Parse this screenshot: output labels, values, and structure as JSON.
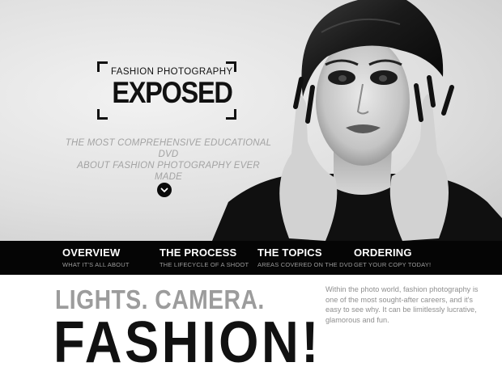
{
  "hero": {
    "logo_top": "FASHION PHOTOGRAPHY",
    "logo_main": "EXPOSED",
    "tagline_line1": "THE MOST COMPREHENSIVE EDUCATIONAL DVD",
    "tagline_line2": "ABOUT FASHION PHOTOGRAPHY EVER MADE",
    "scroll_icon": "chevron-down-icon"
  },
  "nav": {
    "items": [
      {
        "title": "OVERVIEW",
        "subtitle": "WHAT IT'S ALL ABOUT"
      },
      {
        "title": "THE PROCESS",
        "subtitle": "THE LIFECYCLE OF A SHOOT"
      },
      {
        "title": "THE TOPICS",
        "subtitle": "AREAS COVERED ON THE DVD"
      },
      {
        "title": "ORDERING",
        "subtitle": "GET YOUR COPY TODAY!"
      }
    ]
  },
  "content": {
    "headline": "LIGHTS. CAMERA.",
    "big_word": "FASHION!",
    "intro": "Within the photo world, fashion photography is one of the most sought-after careers, and it's easy to see why. It can be limitlessly lucrative, glamorous and fun."
  },
  "colors": {
    "nav_background": "#050505",
    "headline_gray": "#9c9c9c",
    "tagline_gray": "#a3a3a3"
  }
}
